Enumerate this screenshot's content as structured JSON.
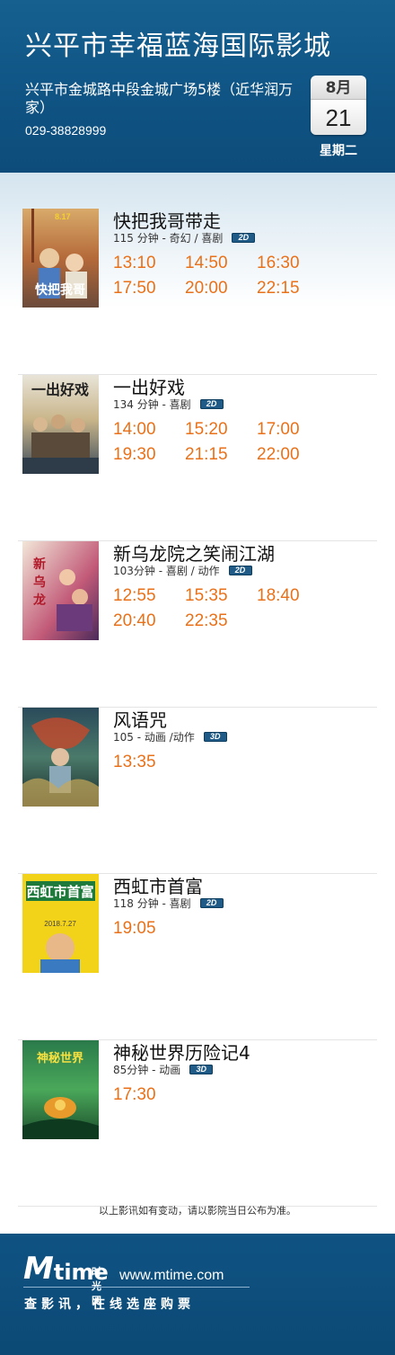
{
  "cinema": {
    "name": "兴平市幸福蓝海国际影城",
    "address": "兴平市金城路中段金城广场5楼（近华润万家）",
    "phone": "029-38828999"
  },
  "date": {
    "month": "8月",
    "day": "21",
    "weekday": "星期二"
  },
  "movies": [
    {
      "title": "快把我哥带走",
      "meta": "115 分钟 - 奇幻 / 喜剧",
      "format": "2D",
      "times": [
        "13:10",
        "14:50",
        "16:30",
        "17:50",
        "20:00",
        "22:15"
      ]
    },
    {
      "title": "一出好戏",
      "meta": "134 分钟 - 喜剧",
      "format": "2D",
      "times": [
        "14:00",
        "15:20",
        "17:00",
        "19:30",
        "21:15",
        "22:00"
      ]
    },
    {
      "title": "新乌龙院之笑闹江湖",
      "meta": "103分钟 - 喜剧 / 动作",
      "format": "2D",
      "times": [
        "12:55",
        "15:35",
        "18:40",
        "20:40",
        "22:35"
      ]
    },
    {
      "title": "风语咒",
      "meta": "105 - 动画 /动作",
      "format": "3D",
      "times": [
        "13:35"
      ]
    },
    {
      "title": "西虹市首富",
      "meta": "118 分钟 - 喜剧",
      "format": "2D",
      "times": [
        "19:05"
      ]
    },
    {
      "title": "神秘世界历险记4",
      "meta": "85分钟 - 动画",
      "format": "3D",
      "times": [
        "17:30"
      ]
    }
  ],
  "notice": "以上影讯如有变动，请以影院当日公布为准。",
  "footer": {
    "logo_m": "M",
    "logo_time": "time",
    "logo_cn": "时光网",
    "url": "www.mtime.com",
    "slogan": "查影讯，在线选座购票"
  },
  "colors": {
    "header": "#0f5383",
    "showtime": "#e8711a",
    "badge": "#1f5b86"
  }
}
